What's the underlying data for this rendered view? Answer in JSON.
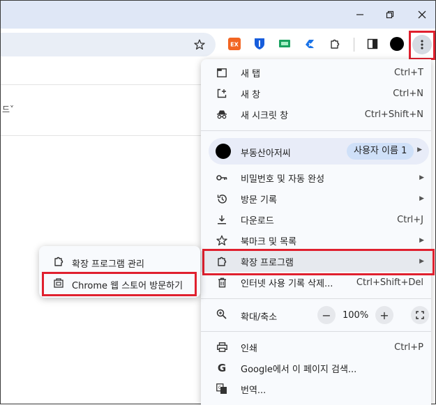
{
  "window": {
    "minimize_icon": "minimize-icon",
    "restore_icon": "restore-icon",
    "close_icon": "close-icon"
  },
  "toolbar": {
    "extensions": [
      {
        "name": "ex-extension-icon",
        "text": "EX",
        "color": "#f26522"
      },
      {
        "name": "bitwarden-icon",
        "color": "#175ddc"
      },
      {
        "name": "screen-extension-icon",
        "color": "#1aa260"
      },
      {
        "name": "close-tabs-extension-icon",
        "color": "#1a73e8"
      },
      {
        "name": "puzzle-icon"
      }
    ],
    "accent": "#e0202e"
  },
  "page": {
    "fragment": "드˅"
  },
  "menu": {
    "items": [
      {
        "label": "새 탭",
        "shortcut": "Ctrl+T",
        "icon": "new-tab-icon"
      },
      {
        "label": "새 창",
        "shortcut": "Ctrl+N",
        "icon": "new-window-icon"
      },
      {
        "label": "새 시크릿 창",
        "shortcut": "Ctrl+Shift+N",
        "icon": "incognito-icon"
      }
    ],
    "profile": {
      "name": "부동산아저씨",
      "pill": "사용자 이름 1"
    },
    "items2": [
      {
        "label": "비밀번호 및 자동 완성",
        "icon": "key-icon"
      },
      {
        "label": "방문 기록",
        "icon": "history-icon"
      },
      {
        "label": "다운로드",
        "shortcut": "Ctrl+J",
        "icon": "download-icon"
      },
      {
        "label": "북마크 및 목록",
        "icon": "star-icon"
      },
      {
        "label": "확장 프로그램",
        "icon": "puzzle-icon"
      },
      {
        "label": "인터넷 사용 기록 삭제...",
        "shortcut": "Ctrl+Shift+Del",
        "icon": "trash-icon"
      }
    ],
    "zoom": {
      "label": "확대/축소",
      "minus": "−",
      "value": "100%",
      "plus": "+"
    },
    "items3": [
      {
        "label": "인쇄",
        "shortcut": "Ctrl+P",
        "icon": "print-icon"
      },
      {
        "label": "Google에서 이 페이지 검색...",
        "icon": "google-icon"
      },
      {
        "label": "번역...",
        "icon": "translate-icon"
      }
    ]
  },
  "submenu": {
    "items": [
      {
        "label": "확장 프로그램 관리",
        "icon": "puzzle-icon"
      },
      {
        "label": "Chrome 웹 스토어 방문하기",
        "icon": "web-store-icon"
      }
    ]
  }
}
